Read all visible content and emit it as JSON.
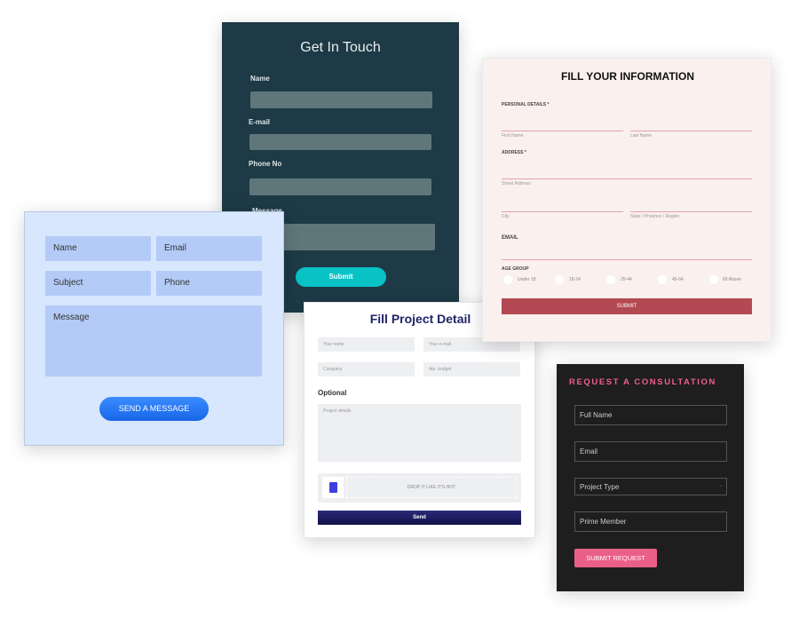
{
  "get_in_touch": {
    "title": "Get In Touch",
    "fields": [
      "Name",
      "E-mail",
      "Phone No",
      "Message"
    ],
    "submit": "Submit",
    "accent": "#08c2c6"
  },
  "contact": {
    "fields": [
      "Name",
      "Email",
      "Subject",
      "Phone"
    ],
    "message": "Message",
    "submit": "SEND A MESSAGE"
  },
  "project": {
    "title": "Fill Project Detail",
    "fields": [
      "Your name",
      "Your e-mail",
      "Company",
      "Apr. budget"
    ],
    "optional": "Optional",
    "details": "Project details",
    "drop": "DROP IT LIKE IT'S HOT",
    "send": "Send",
    "icon": "document-icon"
  },
  "info": {
    "title": "FILL YOUR INFORMATION",
    "personal": "PERSONAL DETAILS *",
    "first": "First Name",
    "last": "Last Name",
    "address": "ADDRESS *",
    "street": "Street Address",
    "city": "City",
    "state": "State / Province / Region",
    "email": "EMAIL",
    "age": "AGE GROUP",
    "ages": [
      "Under 18",
      "18-24",
      "25-44",
      "45-64",
      "65 Above"
    ],
    "submit": "SUBMIT"
  },
  "consult": {
    "title": "REQUEST A CONSULTATION",
    "fields": [
      "Full Name",
      "Email",
      "Project Type",
      "Prime Member"
    ],
    "submit": "SUBMIT REQUEST",
    "accent": "#ea5f88"
  }
}
